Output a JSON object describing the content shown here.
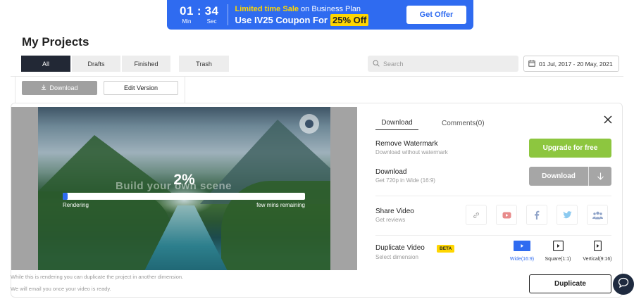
{
  "promo": {
    "minutes": "01",
    "seconds": "34",
    "min_label": "Min",
    "sec_label": "Sec",
    "line1_highlight": "Limited time Sale",
    "line1_rest": " on Business Plan",
    "line2_prefix": "Use IV25 Coupon For",
    "line2_off": "25% Off",
    "button": "Get Offer"
  },
  "header": {
    "title": "My Projects",
    "tabs": [
      "All",
      "Drafts",
      "Finished",
      "Trash"
    ],
    "search_placeholder": "Search",
    "date_range": "01 Jul, 2017 - 20 May, 2021"
  },
  "actions": {
    "download": "Download",
    "edit_version": "Edit Version"
  },
  "video": {
    "percent": "2%",
    "progress": 0.02,
    "watermark": "Build your own scene",
    "rendering": "Rendering",
    "remaining": "few mins remaining"
  },
  "notes": {
    "line1": "While this is rendering you can duplicate the project in another dimension.",
    "line2": "We will email you once your video is ready."
  },
  "panel": {
    "tab_download": "Download",
    "tab_comments": "Comments(0)",
    "remove_watermark": {
      "title": "Remove Watermark",
      "sub": "Download without watermark",
      "button": "Upgrade for free"
    },
    "download": {
      "title": "Download",
      "sub": "Get 720p in Wide (16:9)",
      "button": "Download"
    },
    "share": {
      "title": "Share Video",
      "sub": "Get reviews",
      "icons": [
        "link-icon",
        "youtube-icon",
        "facebook-icon",
        "twitter-icon",
        "team-icon"
      ]
    },
    "duplicate": {
      "title": "Duplicate Video",
      "badge": "BETA",
      "sub": "Select dimension",
      "dims": [
        "Wide(16:9)",
        "Square(1:1)",
        "Vertical(9:16)"
      ],
      "selected": "Wide(16:9)",
      "button": "Duplicate"
    }
  },
  "colors": {
    "brand_blue": "#2f6bf0",
    "upgrade_green": "#8dc63f",
    "badge_yellow": "#ffd600",
    "dark_tab": "#222835"
  }
}
